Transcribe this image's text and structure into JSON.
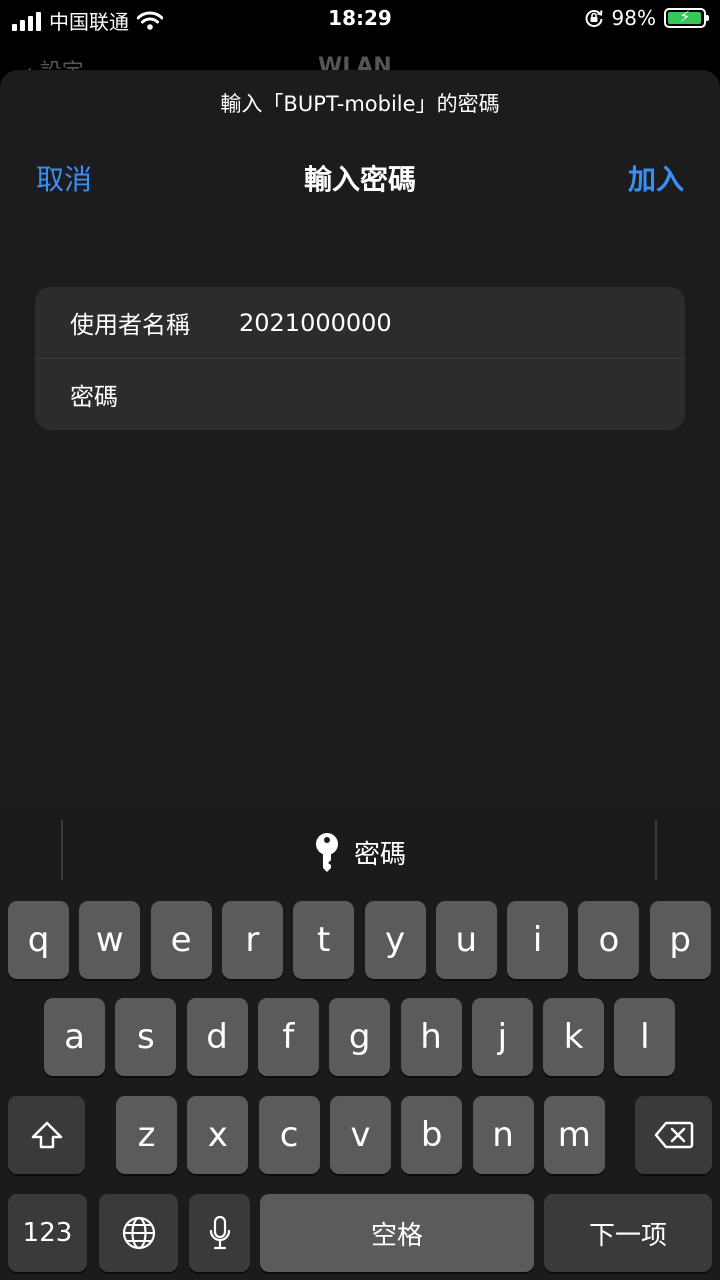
{
  "status_bar": {
    "carrier": "中国联通",
    "time": "18:29",
    "battery_percent": "98%",
    "battery_level": 0.98,
    "battery_color": "#35c759"
  },
  "background": {
    "back_label": "設定",
    "title": "WLAN"
  },
  "sheet": {
    "prompt": "輸入「BUPT-mobile」的密碼",
    "title": "輸入密碼",
    "cancel_label": "取消",
    "join_label": "加入",
    "accent_color": "#3a8ff7"
  },
  "form": {
    "username_label": "使用者名稱",
    "username_value": "2021000000",
    "password_label": "密碼",
    "password_value": ""
  },
  "keyboard": {
    "suggestion": "密碼",
    "row1": [
      "q",
      "w",
      "e",
      "r",
      "t",
      "y",
      "u",
      "i",
      "o",
      "p"
    ],
    "row2": [
      "a",
      "s",
      "d",
      "f",
      "g",
      "h",
      "j",
      "k",
      "l"
    ],
    "row3": [
      "z",
      "x",
      "c",
      "v",
      "b",
      "n",
      "m"
    ],
    "numbers_label": "123",
    "space_label": "空格",
    "next_label": "下一项"
  }
}
